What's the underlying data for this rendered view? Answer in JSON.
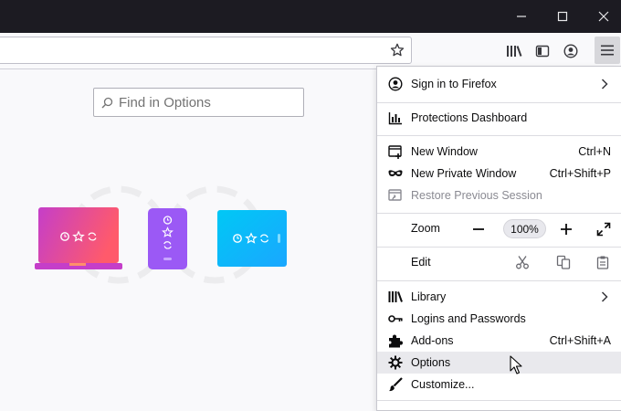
{
  "window_controls": [
    "minimize-icon",
    "maximize-icon",
    "close-icon"
  ],
  "toolbar": {
    "icons": [
      "bookmark-star-icon",
      "library-icon",
      "sidebars-icon",
      "account-icon",
      "hamburger-menu-icon"
    ]
  },
  "content": {
    "search": {
      "placeholder": "Find in Options"
    },
    "sync_art": [
      "laptop-illustration",
      "phone-illustration",
      "tablet-illustration"
    ]
  },
  "menu": {
    "sign_in": "Sign in to Firefox",
    "protections": "Protections Dashboard",
    "new_window": {
      "label": "New Window",
      "shortcut": "Ctrl+N"
    },
    "new_private": {
      "label": "New Private Window",
      "shortcut": "Ctrl+Shift+P"
    },
    "restore": "Restore Previous Session",
    "zoom": {
      "label": "Zoom",
      "minus": "−",
      "value": "100%",
      "plus": "+"
    },
    "edit": {
      "label": "Edit"
    },
    "library": "Library",
    "logins": "Logins and Passwords",
    "addons": {
      "label": "Add-ons",
      "shortcut": "Ctrl+Shift+A"
    },
    "options": "Options",
    "customize": "Customize..."
  },
  "colors": {
    "titlebar": "#1c1b22",
    "hover_row": "#e9e9ed",
    "laptop_gradient": [
      "#c53ec9",
      "#ff5a6b"
    ],
    "phone": "#9b59f5",
    "tablet_gradient": [
      "#00c8f5",
      "#1aa7ff"
    ]
  }
}
